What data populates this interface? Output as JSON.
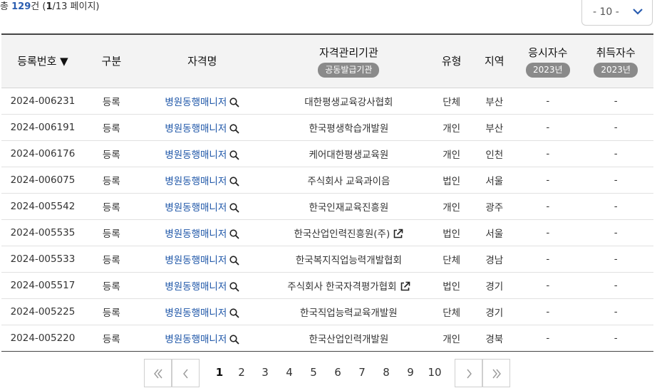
{
  "summary": {
    "prefix": "총",
    "count": "129",
    "unit": "건",
    "open": "(",
    "current_page": "1",
    "total_pages": "/13",
    "page_suffix": "페이지)"
  },
  "page_size": {
    "selected": "- 10 -"
  },
  "headers": {
    "reg_no": "등록번호 ▼",
    "category": "구분",
    "qual_name": "자격명",
    "org": "자격관리기관",
    "org_badge": "공동발급기관",
    "type": "유형",
    "region": "지역",
    "examinees": "응시자수",
    "examinees_badge": "2023년",
    "acquirers": "취득자수",
    "acquirers_badge": "2023년"
  },
  "rows": [
    {
      "reg_no": "2024-006231",
      "category": "등록",
      "qual_name": "병원동행매니저",
      "org": "대한평생교육강사협회",
      "external": false,
      "type": "단체",
      "region": "부산",
      "examinees": "-",
      "acquirers": "-"
    },
    {
      "reg_no": "2024-006191",
      "category": "등록",
      "qual_name": "병원동행매니저",
      "org": "한국평생학습개발원",
      "external": false,
      "type": "개인",
      "region": "부산",
      "examinees": "-",
      "acquirers": "-"
    },
    {
      "reg_no": "2024-006176",
      "category": "등록",
      "qual_name": "병원동행매니저",
      "org": "케어대한평생교육원",
      "external": false,
      "type": "개인",
      "region": "인천",
      "examinees": "-",
      "acquirers": "-"
    },
    {
      "reg_no": "2024-006075",
      "category": "등록",
      "qual_name": "병원동행매니저",
      "org": "주식회사 교육과이음",
      "external": false,
      "type": "법인",
      "region": "서울",
      "examinees": "-",
      "acquirers": "-"
    },
    {
      "reg_no": "2024-005542",
      "category": "등록",
      "qual_name": "병원동행매니저",
      "org": "한국인재교육진흥원",
      "external": false,
      "type": "개인",
      "region": "광주",
      "examinees": "-",
      "acquirers": "-"
    },
    {
      "reg_no": "2024-005535",
      "category": "등록",
      "qual_name": "병원동행매니저",
      "org": "한국산업인력진흥원(주)",
      "external": true,
      "type": "법인",
      "region": "서울",
      "examinees": "-",
      "acquirers": "-"
    },
    {
      "reg_no": "2024-005533",
      "category": "등록",
      "qual_name": "병원동행매니저",
      "org": "한국복지직업능력개발협회",
      "external": false,
      "type": "단체",
      "region": "경남",
      "examinees": "-",
      "acquirers": "-"
    },
    {
      "reg_no": "2024-005517",
      "category": "등록",
      "qual_name": "병원동행매니저",
      "org": "주식회사 한국자격평가협회",
      "external": true,
      "type": "법인",
      "region": "경기",
      "examinees": "-",
      "acquirers": "-"
    },
    {
      "reg_no": "2024-005225",
      "category": "등록",
      "qual_name": "병원동행매니저",
      "org": "한국직업능력교육개발원",
      "external": false,
      "type": "단체",
      "region": "경기",
      "examinees": "-",
      "acquirers": "-"
    },
    {
      "reg_no": "2024-005220",
      "category": "등록",
      "qual_name": "병원동행매니저",
      "org": "한국산업인력개발원",
      "external": false,
      "type": "개인",
      "region": "경북",
      "examinees": "-",
      "acquirers": "-"
    }
  ],
  "pagination": {
    "pages": [
      "1",
      "2",
      "3",
      "4",
      "5",
      "6",
      "7",
      "8",
      "9",
      "10"
    ],
    "current": "1"
  }
}
